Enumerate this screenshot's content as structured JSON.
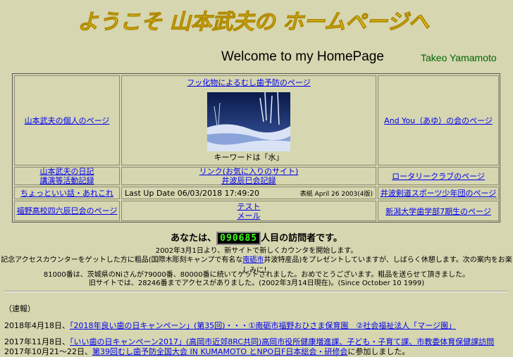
{
  "header": {
    "banner": "ようこそ  山本武夫の  ホームページへ",
    "welcome": "Welcome to my HomePage",
    "author": "Takeo Yamamoto"
  },
  "table": {
    "personal": "山本武夫の個人のページ",
    "fluoride": "フッ化物によるむし歯予防のページ",
    "keyword": "キーワードは「水」",
    "ayu": "And  You（あゆ）の会のページ",
    "diary1": "山本武夫の日記",
    "diary2": "講演等活動記録",
    "links1": "リンク(お気に入りのサイト)",
    "links2": "井波辰巳会記録",
    "rotary": "ロータリークラブのページ",
    "chotto": "ちょっといい話・あれこれ",
    "update": "Last Up Date 06/03/2018 17:49:20",
    "cover": "表紙  April  26  2003(4版)",
    "kendo": "井波剣道スポーツ少年団のページ",
    "highschool": "福野高校四六辰巳会のページ",
    "test": "テスト",
    "mail": "メール",
    "niigata": "新潟大学歯学部7期生のページ"
  },
  "counter": {
    "prefix": "あなたは、",
    "digits": "090685",
    "suffix": "人目の訪問者です。"
  },
  "notes": {
    "line1": "2002年3月1日より、新サイトで新しくカウンタを開始します。",
    "line2a": "記念アクセスカウンターをゲットした方に粗品(国際木彫刻キャンプで有名な",
    "line2link": "南砺市",
    "line2b": "井波特産品)をプレゼントしていますが、しばらく休憩します。次の案内をお楽しみに！",
    "line3": "81000番は、茨城県のNiさんが79000番、80000番に続いてゲットされました。おめでとうございます。粗品を送らせて頂きました。",
    "line4": "旧サイトでは、28246番までアクセスがありました。(2002年3月14日現在)。(Since    October 10 1999)"
  },
  "news": {
    "heading": "（速報）",
    "item1_date": "2018年4月18日、",
    "item1_link": "「2018年良い歯の日キャンペーン」(第35回)・・・①南砺市福野おひさま保育園　②社会福祉法人「マージ園」",
    "item2_date": "2017年11月8日、",
    "item2_link": "「いい歯の日キャンペーン2017」(高岡市近郊8RC共同)高岡市役所健康増進課、子ども・子育て課、市教委体育保健課訪問",
    "item3_date": "2017年10月21～22日、",
    "item3_link": "第39回むし歯予防全国大会  IN KUMAMOTO とNPO日F日本総会・研修会",
    "item3_tail": "に参加しました。"
  }
}
